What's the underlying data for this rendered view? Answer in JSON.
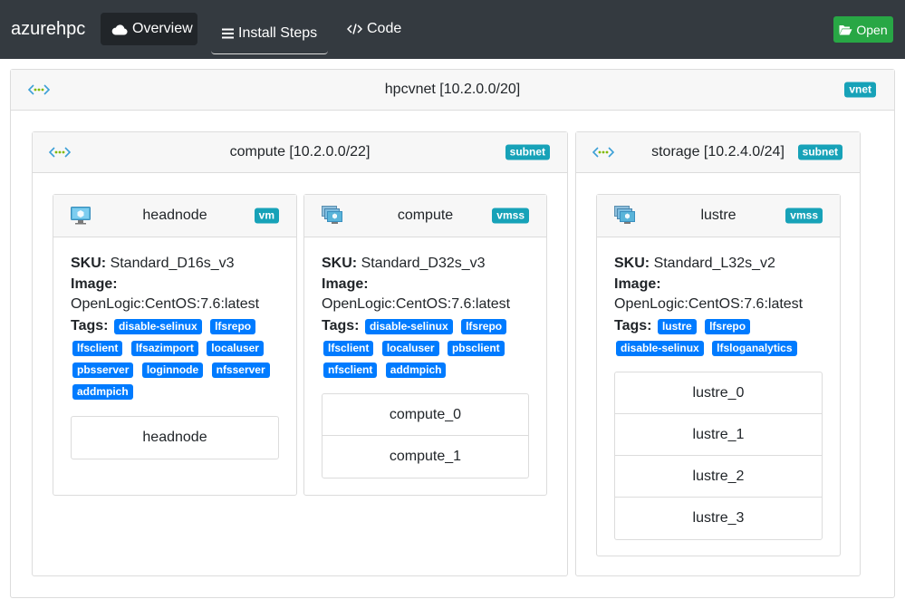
{
  "nav": {
    "brand": "azurehpc",
    "overview": "Overview",
    "install_steps": "Install Steps",
    "code": "Code",
    "open": "Open"
  },
  "vnet": {
    "title": "hpcvnet [10.2.0.0/20]",
    "badge": "vnet"
  },
  "subnets": [
    {
      "title": "compute [10.2.0.0/22]",
      "badge": "subnet",
      "resources": [
        {
          "title": "headnode",
          "badge": "vm",
          "sku_label": "SKU:",
          "sku": "Standard_D16s_v3",
          "image_label": "Image:",
          "image": "OpenLogic:CentOS:7.6:latest",
          "tags_label": "Tags:",
          "tags": [
            "disable-selinux",
            "lfsrepo",
            "lfsclient",
            "lfsazimport",
            "localuser",
            "pbsserver",
            "loginnode",
            "nfsserver",
            "addmpich"
          ],
          "instances": [
            "headnode"
          ]
        },
        {
          "title": "compute",
          "badge": "vmss",
          "sku_label": "SKU:",
          "sku": "Standard_D32s_v3",
          "image_label": "Image:",
          "image": "OpenLogic:CentOS:7.6:latest",
          "tags_label": "Tags:",
          "tags": [
            "disable-selinux",
            "lfsrepo",
            "lfsclient",
            "localuser",
            "pbsclient",
            "nfsclient",
            "addmpich"
          ],
          "instances": [
            "compute_0",
            "compute_1"
          ]
        }
      ]
    },
    {
      "title": "storage [10.2.4.0/24]",
      "badge": "subnet",
      "resources": [
        {
          "title": "lustre",
          "badge": "vmss",
          "sku_label": "SKU:",
          "sku": "Standard_L32s_v2",
          "image_label": "Image:",
          "image": "OpenLogic:CentOS:7.6:latest",
          "tags_label": "Tags:",
          "tags": [
            "lustre",
            "lfsrepo",
            "disable-selinux",
            "lfsloganalytics"
          ],
          "instances": [
            "lustre_0",
            "lustre_1",
            "lustre_2",
            "lustre_3"
          ]
        }
      ]
    }
  ],
  "colors": {
    "navbar": "#343a40",
    "active_nav": "#212529",
    "open_button": "#28a745",
    "info_badge": "#17a2b8",
    "tag": "#007bff"
  }
}
